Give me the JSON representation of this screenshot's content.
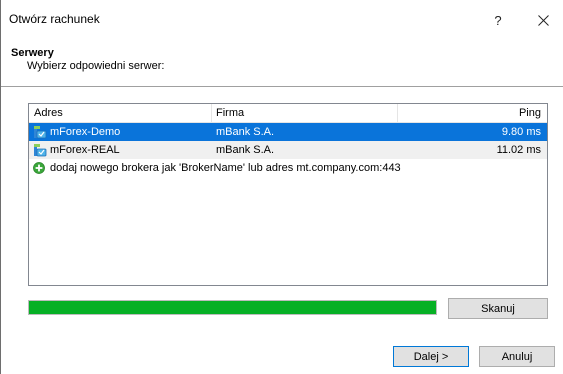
{
  "window": {
    "title": "Otwórz rachunek",
    "help_label": "?",
    "close_label": "×"
  },
  "header": {
    "title": "Serwery",
    "subtitle": "Wybierz odpowiedni serwer:"
  },
  "servers_table": {
    "columns": [
      "Adres",
      "Firma",
      "Ping"
    ],
    "rows": [
      {
        "adres": "mForex-Demo",
        "firma": "mBank S.A.",
        "ping": "9.80 ms",
        "selected": true
      },
      {
        "adres": "mForex-REAL",
        "firma": "mBank S.A.",
        "ping": "11.02 ms",
        "selected": false
      }
    ],
    "add_broker_text": "dodaj nowego brokera jak 'BrokerName' lub adres mt.company.com:443"
  },
  "scan": {
    "progress_fraction": 1.0,
    "scan_button_label": "Skanuj"
  },
  "footer": {
    "next_label": "Dalej >",
    "cancel_label": "Anuluj"
  },
  "colors": {
    "selection": "#0a74da",
    "progress": "#06b025",
    "add_icon": "#3aa63a"
  },
  "icons": {
    "server": "server-broker-icon",
    "add": "add-plus-icon",
    "close": "close-icon"
  }
}
